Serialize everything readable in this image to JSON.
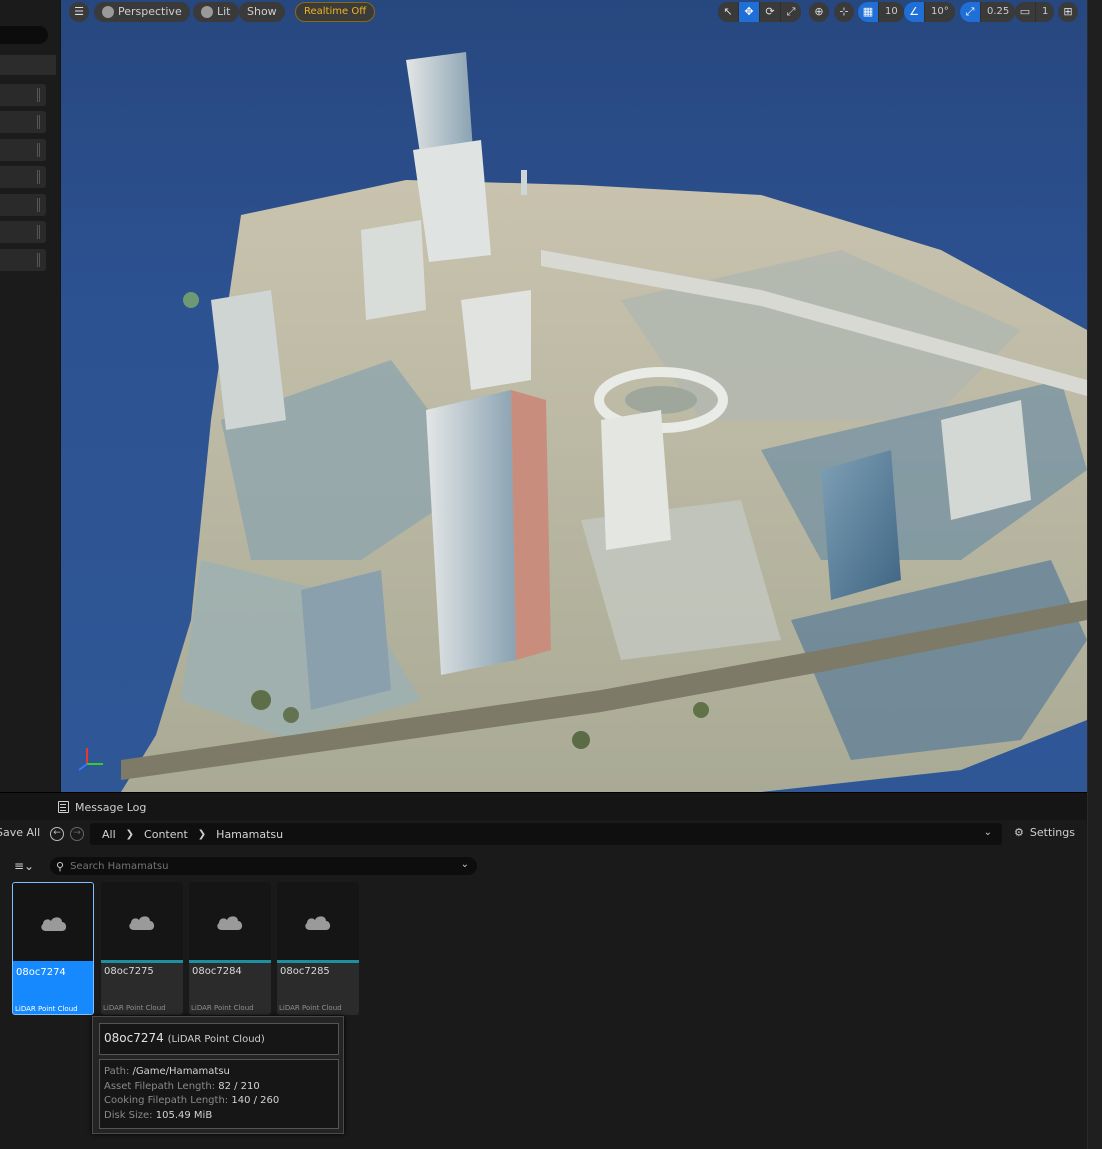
{
  "viewport": {
    "toolbar": {
      "view_mode": "Perspective",
      "lighting": "Lit",
      "show": "Show",
      "realtime": "Realtime Off",
      "grid_snap": "10",
      "rotate_snap": "10°",
      "scale_snap": "0.25",
      "camera_speed": "1"
    }
  },
  "message_log": {
    "label": "Message Log"
  },
  "content_browser": {
    "save_all": "Save All",
    "breadcrumb": [
      "All",
      "Content",
      "Hamamatsu"
    ],
    "settings": "Settings",
    "search_placeholder": "Search Hamamatsu",
    "assets": [
      {
        "name": "08oc7274",
        "type": "LiDAR Point Cloud",
        "selected": true
      },
      {
        "name": "08oc7275",
        "type": "LiDAR Point Cloud",
        "selected": false
      },
      {
        "name": "08oc7284",
        "type": "LiDAR Point Cloud",
        "selected": false
      },
      {
        "name": "08oc7285",
        "type": "LiDAR Point Cloud",
        "selected": false
      }
    ],
    "tooltip": {
      "name": "08oc7274",
      "type": "(LiDAR Point Cloud)",
      "path_label": "Path:",
      "path": "/Game/Hamamatsu",
      "asset_len_label": "Asset Filepath Length:",
      "asset_len": "82 / 210",
      "cook_len_label": "Cooking Filepath Length:",
      "cook_len": "140 / 260",
      "disk_label": "Disk Size:",
      "disk": "105.49 MiB"
    }
  },
  "colors": {
    "accent": "#1f6fd6",
    "selected_tile": "#1789ff",
    "realtime": "#f1b51c",
    "type_strip": "#1c8fa0"
  }
}
